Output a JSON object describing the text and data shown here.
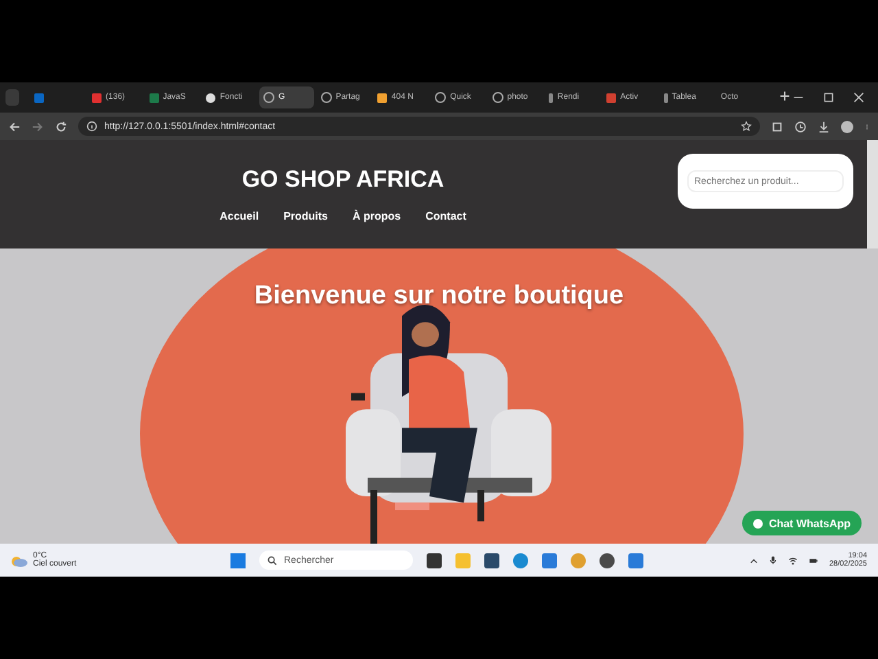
{
  "tabs": [
    {
      "selected": false
    },
    {
      "label": "(136)",
      "selected": false
    },
    {
      "label": "JavaS",
      "selected": false
    },
    {
      "label": "Foncti",
      "selected": false
    },
    {
      "label": "G",
      "selected": true
    },
    {
      "label": "Partag",
      "selected": false
    },
    {
      "label": "404 N",
      "selected": false
    },
    {
      "label": "Quick",
      "selected": false
    },
    {
      "label": "photo",
      "selected": false
    },
    {
      "label": "Rendi",
      "selected": false
    },
    {
      "label": "Activ",
      "selected": false
    },
    {
      "label": "Tablea",
      "selected": false
    },
    {
      "label": "Octo",
      "selected": false
    }
  ],
  "address_bar": {
    "url": "http://127.0.0.1:5501/index.html#contact"
  },
  "site": {
    "title": "GO SHOP AFRICA",
    "nav": [
      "Accueil",
      "Produits",
      "À propos",
      "Contact"
    ],
    "search": {
      "placeholder": "Recherchez un produit..."
    }
  },
  "hero": {
    "heading": "Bienvenue sur notre boutique"
  },
  "chat_button": {
    "label": "Chat WhatsApp"
  },
  "taskbar": {
    "temperature": "0°C",
    "weather": "Ciel couvert",
    "search_placeholder": "Rechercher",
    "time": "19:04",
    "date": "28/02/2025"
  }
}
